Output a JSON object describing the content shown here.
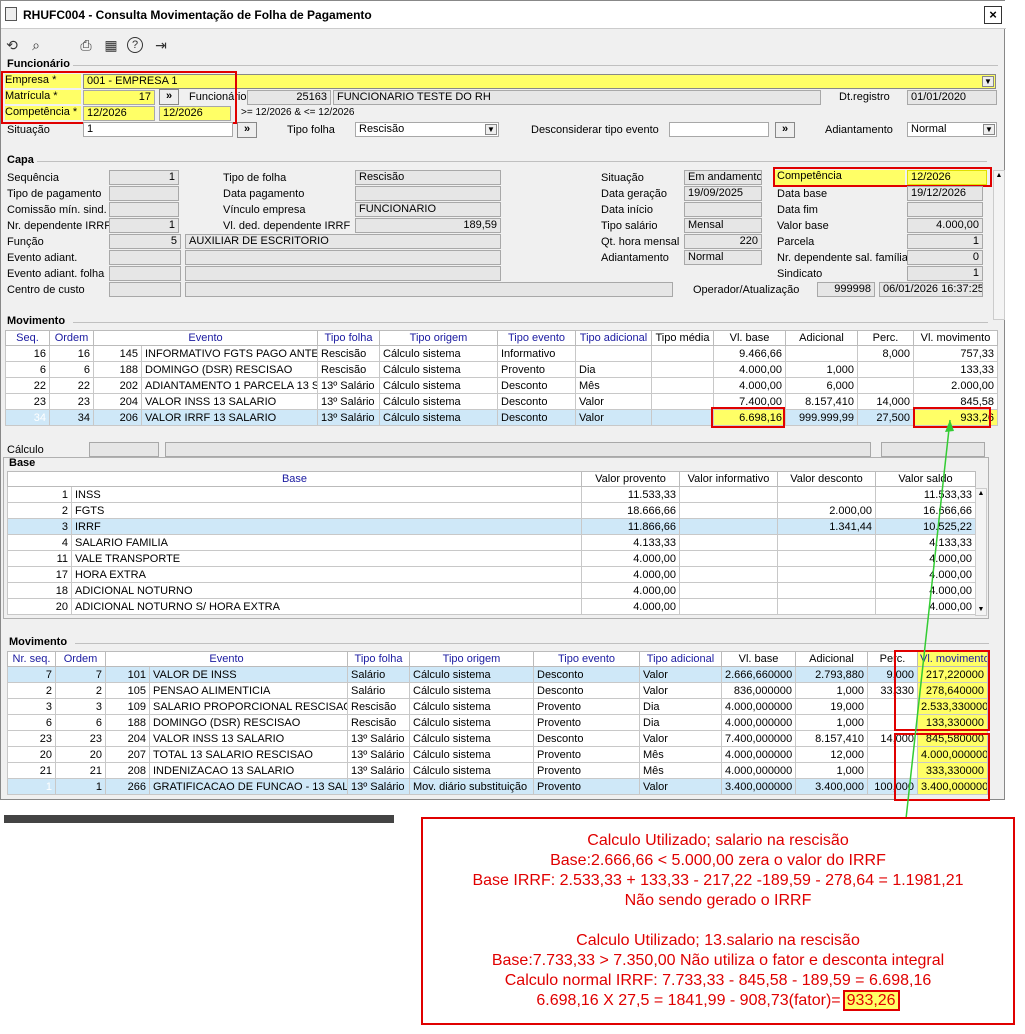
{
  "window": {
    "title": "RHUFC004 - Consulta Movimentação de Folha de Pagamento",
    "close": "×"
  },
  "toolbar": [
    {
      "icon": "undo-icon",
      "glyph": "⟲"
    },
    {
      "icon": "search-icon",
      "glyph": "⌕"
    },
    {
      "icon": "print-icon",
      "glyph": "⎙"
    },
    {
      "icon": "calendar-icon",
      "glyph": "▦"
    },
    {
      "icon": "help-icon",
      "glyph": "?"
    },
    {
      "icon": "exit-icon",
      "glyph": "⇥"
    }
  ],
  "funcionario": {
    "section": "Funcionário",
    "empresa_label": "Empresa *",
    "empresa_value": "001 - EMPRESA 1",
    "matricula_label": "Matrícula *",
    "matricula_value": "17",
    "lookup_btn": "»",
    "funcionario_label": "Funcionário",
    "funcionario_code": "25163",
    "funcionario_name": "FUNCIONARIO TESTE DO RH",
    "dtregistro_label": "Dt.registro",
    "dtregistro_value": "01/01/2020",
    "competencia_label": "Competência *",
    "competencia_from": "12/2026",
    "competencia_to": "12/2026",
    "competencia_hint": ">= 12/2026 & <= 12/2026",
    "situacao_label": "Situação",
    "situacao_value": "1",
    "tipofolha_label": "Tipo folha",
    "tipofolha_value": "Rescisão",
    "desconsiderar_label": "Desconsiderar tipo evento",
    "adiantamento_label": "Adiantamento",
    "adiantamento_value": "Normal"
  },
  "capa": {
    "section": "Capa",
    "sequencia_label": "Sequência",
    "sequencia": "1",
    "tipopag_label": "Tipo de pagamento",
    "comissao_label": "Comissão mín. sind.",
    "nrdep_label": "Nr. dependente IRRF",
    "nrdep": "1",
    "funcao_label": "Função",
    "funcao_code": "5",
    "funcao_name": "AUXILIAR DE ESCRITORIO",
    "evadiant_label": "Evento adiant.",
    "evadiantfolha_label": "Evento adiant. folha",
    "centro_label": "Centro de custo",
    "tipofolha_label": "Tipo de folha",
    "tipofolha": "Rescisão",
    "datapag_label": "Data pagamento",
    "vinculo_label": "Vínculo empresa",
    "vinculo": "FUNCIONARIO",
    "vlded_label": "Vl. ded. dependente IRRF",
    "vlded": "189,59",
    "situacao_label": "Situação",
    "situacao": "Em andamento",
    "datager_label": "Data geração",
    "datager": "19/09/2025",
    "datainicio_label": "Data início",
    "tiposal_label": "Tipo salário",
    "tiposal": "Mensal",
    "qthora_label": "Qt. hora mensal",
    "qthora": "220",
    "adiant_label": "Adiantamento",
    "adiant": "Normal",
    "comp_label": "Competência",
    "comp": "12/2026",
    "database_label": "Data base",
    "database": "19/12/2026",
    "datafim_label": "Data fim",
    "valorbase_label": "Valor base",
    "valorbase": "4.000,00",
    "parcela_label": "Parcela",
    "parcela": "1",
    "nrdepsal_label": "Nr. dependente sal. família",
    "nrdepsal": "0",
    "sindicato_label": "Sindicato",
    "sindicato": "1",
    "operador_label": "Operador/Atualização",
    "operador": "999998",
    "atualizacao": "06/01/2026 16:37:25"
  },
  "movimento1": {
    "section": "Movimento",
    "headers": [
      "Seq.",
      "Ordem",
      "Evento",
      "Tipo folha",
      "Tipo origem",
      "Tipo evento",
      "Tipo adicional",
      "Tipo média",
      "Vl. base",
      "Adicional",
      "Perc.",
      "Vl. movimento"
    ],
    "rows": [
      [
        "16",
        "16",
        "145",
        "INFORMATIVO FGTS PAGO ANTECIP",
        "Rescisão",
        "Cálculo sistema",
        "Informativo",
        "",
        "",
        "9.466,66",
        "",
        "8,000",
        "757,33"
      ],
      [
        "6",
        "6",
        "188",
        "DOMINGO (DSR) RESCISAO",
        "Rescisão",
        "Cálculo sistema",
        "Provento",
        "Dia",
        "",
        "4.000,00",
        "1,000",
        "",
        "133,33"
      ],
      [
        "22",
        "22",
        "202",
        "ADIANTAMENTO 1 PARCELA 13 SA",
        "13º Salário",
        "Cálculo sistema",
        "Desconto",
        "Mês",
        "",
        "4.000,00",
        "6,000",
        "",
        "2.000,00"
      ],
      [
        "23",
        "23",
        "204",
        "VALOR INSS 13 SALARIO",
        "13º Salário",
        "Cálculo sistema",
        "Desconto",
        "Valor",
        "",
        "7.400,00",
        "8.157,410",
        "14,000",
        "845,58"
      ],
      [
        "34",
        "34",
        "206",
        "VALOR IRRF 13 SALARIO",
        "13º Salário",
        "Cálculo sistema",
        "Desconto",
        "Valor",
        "",
        "6.698,16",
        "999.999,99",
        "27,500",
        "933,26"
      ]
    ],
    "calculo_label": "Cálculo"
  },
  "base": {
    "section": "Base",
    "headers": [
      "Base",
      "Valor provento",
      "Valor informativo",
      "Valor desconto",
      "Valor saldo"
    ],
    "rows": [
      [
        "1",
        "INSS",
        "11.533,33",
        "",
        "",
        "11.533,33"
      ],
      [
        "2",
        "FGTS",
        "18.666,66",
        "",
        "2.000,00",
        "16.666,66"
      ],
      [
        "3",
        "IRRF",
        "11.866,66",
        "",
        "1.341,44",
        "10.525,22"
      ],
      [
        "4",
        "SALARIO FAMILIA",
        "4.133,33",
        "",
        "",
        "4.133,33"
      ],
      [
        "11",
        "VALE TRANSPORTE",
        "4.000,00",
        "",
        "",
        "4.000,00"
      ],
      [
        "17",
        "HORA EXTRA",
        "4.000,00",
        "",
        "",
        "4.000,00"
      ],
      [
        "18",
        "ADICIONAL NOTURNO",
        "4.000,00",
        "",
        "",
        "4.000,00"
      ],
      [
        "20",
        "ADICIONAL NOTURNO S/ HORA EXTRA",
        "4.000,00",
        "",
        "",
        "4.000,00"
      ]
    ]
  },
  "movimento2": {
    "section": "Movimento",
    "headers": [
      "Nr. seq.",
      "Ordem",
      "Evento",
      "Tipo folha",
      "Tipo origem",
      "Tipo evento",
      "Tipo adicional",
      "Vl. base",
      "Adicional",
      "Perc.",
      "Vl. movimento"
    ],
    "rows": [
      [
        "7",
        "7",
        "101",
        "VALOR DE INSS",
        "Salário",
        "Cálculo sistema",
        "Desconto",
        "Valor",
        "2.666,660000",
        "2.793,880",
        "9,000",
        "217,220000"
      ],
      [
        "2",
        "2",
        "105",
        "PENSAO ALIMENTICIA",
        "Salário",
        "Cálculo sistema",
        "Desconto",
        "Valor",
        "836,000000",
        "1,000",
        "33,330",
        "278,640000"
      ],
      [
        "3",
        "3",
        "109",
        "SALARIO PROPORCIONAL RESCISAO",
        "Rescisão",
        "Cálculo sistema",
        "Provento",
        "Dia",
        "4.000,000000",
        "19,000",
        "",
        "2.533,330000"
      ],
      [
        "6",
        "6",
        "188",
        "DOMINGO (DSR) RESCISAO",
        "Rescisão",
        "Cálculo sistema",
        "Provento",
        "Dia",
        "4.000,000000",
        "1,000",
        "",
        "133,330000"
      ],
      [
        "23",
        "23",
        "204",
        "VALOR INSS 13 SALARIO",
        "13º Salário",
        "Cálculo sistema",
        "Desconto",
        "Valor",
        "7.400,000000",
        "8.157,410",
        "14,000",
        "845,580000"
      ],
      [
        "20",
        "20",
        "207",
        "TOTAL 13 SALARIO RESCISAO",
        "13º Salário",
        "Cálculo sistema",
        "Provento",
        "Mês",
        "4.000,000000",
        "12,000",
        "",
        "4.000,000000"
      ],
      [
        "21",
        "21",
        "208",
        "INDENIZACAO 13 SALARIO",
        "13º Salário",
        "Cálculo sistema",
        "Provento",
        "Mês",
        "4.000,000000",
        "1,000",
        "",
        "333,330000"
      ],
      [
        "1",
        "1",
        "266",
        "GRATIFICACAO DE FUNCAO - 13 SALA",
        "13º Salário",
        "Mov. diário substituição",
        "Provento",
        "Valor",
        "3.400,000000",
        "3.400,000",
        "100,000",
        "3.400,000000"
      ]
    ]
  },
  "note": {
    "lines": [
      "Calculo Utilizado; salario na rescisão",
      "Base:2.666,66 < 5.000,00 zera o valor do IRRF",
      "Base IRRF: 2.533,33 + 133,33 - 217,22 -189,59 - 278,64 = 1.1981,21",
      "Não sendo gerado o IRRF",
      "",
      "Calculo Utilizado; 13.salario na rescisão",
      "Base:7.733,33 > 7.350,00 Não utiliza o fator e desconta integral",
      "Calculo normal IRRF: 7.733,33 - 845,58 - 189,59 = 6.698,16"
    ],
    "last_prefix": "6.698,16 X 27,5 = 1841,99 - 908,73(fator)=",
    "last_value": "933,26"
  },
  "colors": {
    "highlight": "#ffff66",
    "annotation": "#e00000",
    "arrow": "#33cc33",
    "header_text": "#1a1aa0",
    "selection": "#cfe8f8"
  }
}
